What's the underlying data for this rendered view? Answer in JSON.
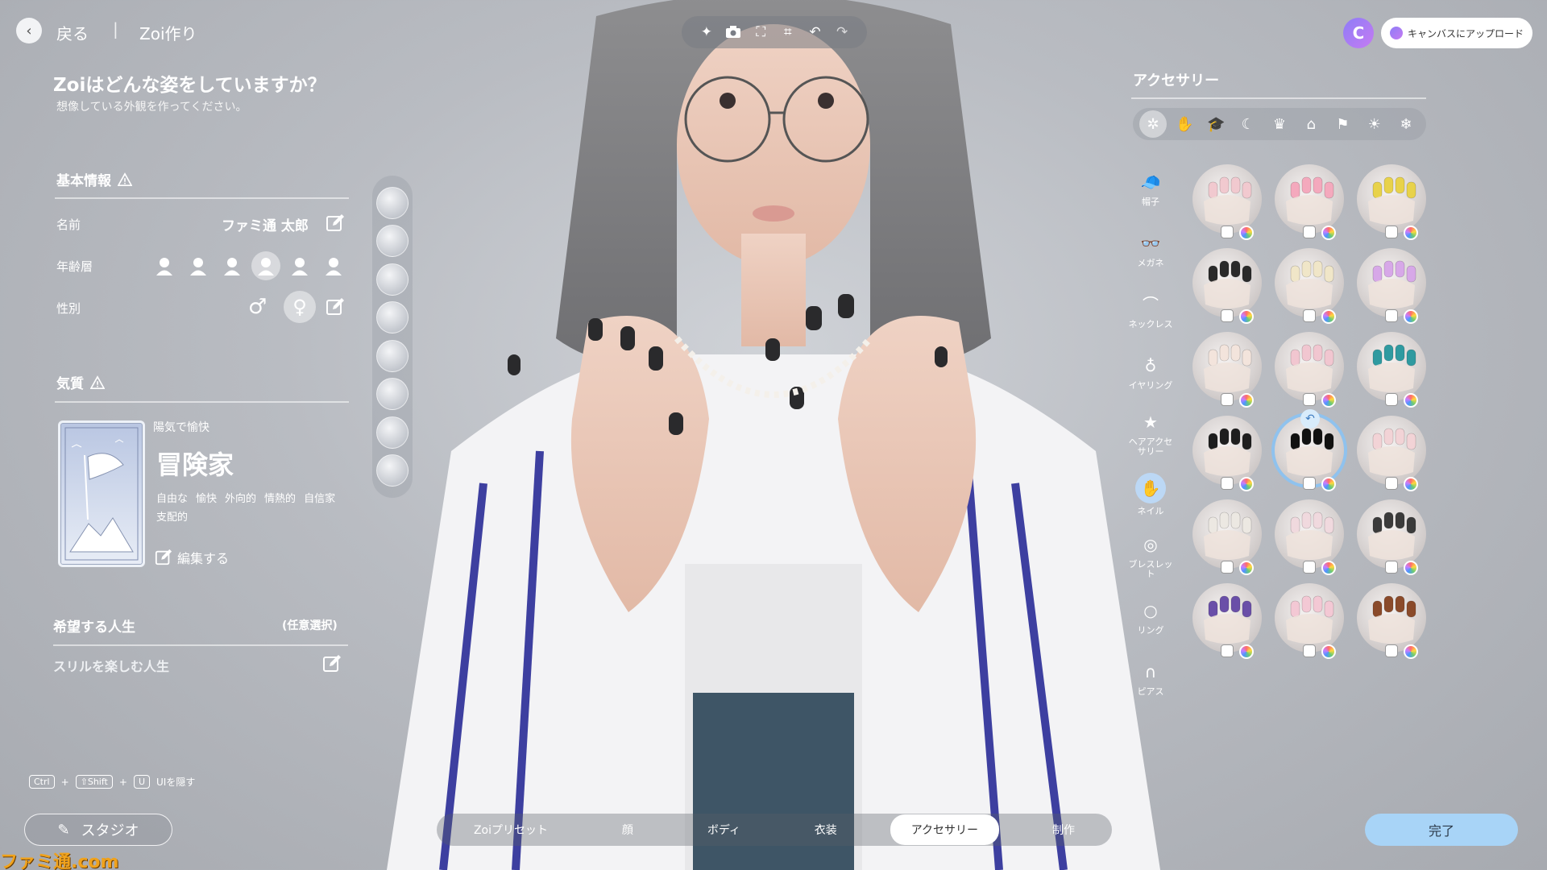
{
  "header": {
    "back_label": "戻る",
    "separator": "|",
    "title": "Zoi作り",
    "toolbar_icons": [
      "sparkle-icon",
      "camera-icon",
      "focus-frame-icon",
      "face-frame-icon",
      "undo-icon",
      "redo-icon"
    ],
    "upload_label": "キャンバスにアップロード",
    "credit_letter": "C"
  },
  "intro": {
    "title": "Zoiはどんな姿をしていますか？",
    "subtitle": "想像している外観を作ってください。"
  },
  "basic_info": {
    "title": "基本情報",
    "name_label": "名前",
    "name_value": "ファミ通 太郎",
    "age_label": "年齢層",
    "age_options": [
      "infant-icon",
      "child-icon",
      "teen-icon",
      "young-adult-icon",
      "adult-icon",
      "elder-icon"
    ],
    "age_selected_index": 3,
    "gender_label": "性別",
    "gender_male": "♂",
    "gender_female": "♀",
    "gender_selected": "female"
  },
  "temperament": {
    "title": "気質",
    "card_label": "陽気で愉快",
    "card_name": "冒険家",
    "traits": [
      "自由な",
      "愉快",
      "外向的",
      "情熱的",
      "自信家",
      "支配的"
    ],
    "edit_label": "編集する"
  },
  "life": {
    "title": "希望する人生",
    "optional": "(任意選択)",
    "value": "スリルを楽しむ人生"
  },
  "hotkey": {
    "keys": [
      "Ctrl",
      "⇧Shift",
      "U"
    ],
    "plus": "+",
    "action": "UIを隠す"
  },
  "studio_label": "スタジオ",
  "watermark": "ファミ通.com",
  "slot_strip": [
    "socks-slot",
    "shoes-slot",
    "outfit-slot",
    "necklace-slot",
    "nails-slot",
    "head-slot",
    "glasses-slot",
    "hairband-slot"
  ],
  "accessory": {
    "title": "アクセサリー",
    "category_icons": [
      "magic-icon",
      "hands-icon",
      "cap-icon",
      "moon-icon",
      "crown-icon",
      "hat-icon",
      "dog-icon",
      "sun-icon",
      "snow-icon"
    ],
    "category_selected_index": 0,
    "side_items": [
      {
        "icon": "cap-icon",
        "glyph": "🧢",
        "label": "帽子"
      },
      {
        "icon": "glasses-icon",
        "glyph": "👓",
        "label": "メガネ"
      },
      {
        "icon": "necklace-icon",
        "glyph": "⌒",
        "label": "ネックレス"
      },
      {
        "icon": "earring-icon",
        "glyph": "♁",
        "label": "イヤリング"
      },
      {
        "icon": "hair-accessory-icon",
        "glyph": "★",
        "label": "ヘアアクセサリー"
      },
      {
        "icon": "nail-icon",
        "glyph": "✋",
        "label": "ネイル"
      },
      {
        "icon": "bracelet-icon",
        "glyph": "◎",
        "label": "ブレスレット"
      },
      {
        "icon": "ring-icon",
        "glyph": "○",
        "label": "リング"
      },
      {
        "icon": "piercing-icon",
        "glyph": "∩",
        "label": "ピアス"
      }
    ],
    "side_selected_index": 5,
    "nail_colors": [
      "#f1c9cf",
      "#f4a9bd",
      "#e8d24a",
      "#2a2a2a",
      "#f0e6c8",
      "#d7a8e8",
      "#f3e4dc",
      "#f1c6d0",
      "#2f9aa0",
      "#1e1e1e",
      "#111111",
      "#f2d3d6",
      "#ece8e2",
      "#f0d9de",
      "#3b3b3b",
      "#6a4fa8",
      "#f3c8d4",
      "#8a4a2a"
    ],
    "nail_selected_index": 10
  },
  "tabs": [
    "Zoiプリセット",
    "顔",
    "ボディ",
    "衣装",
    "アクセサリー",
    "制作"
  ],
  "tab_selected_index": 4,
  "done_label": "完了"
}
